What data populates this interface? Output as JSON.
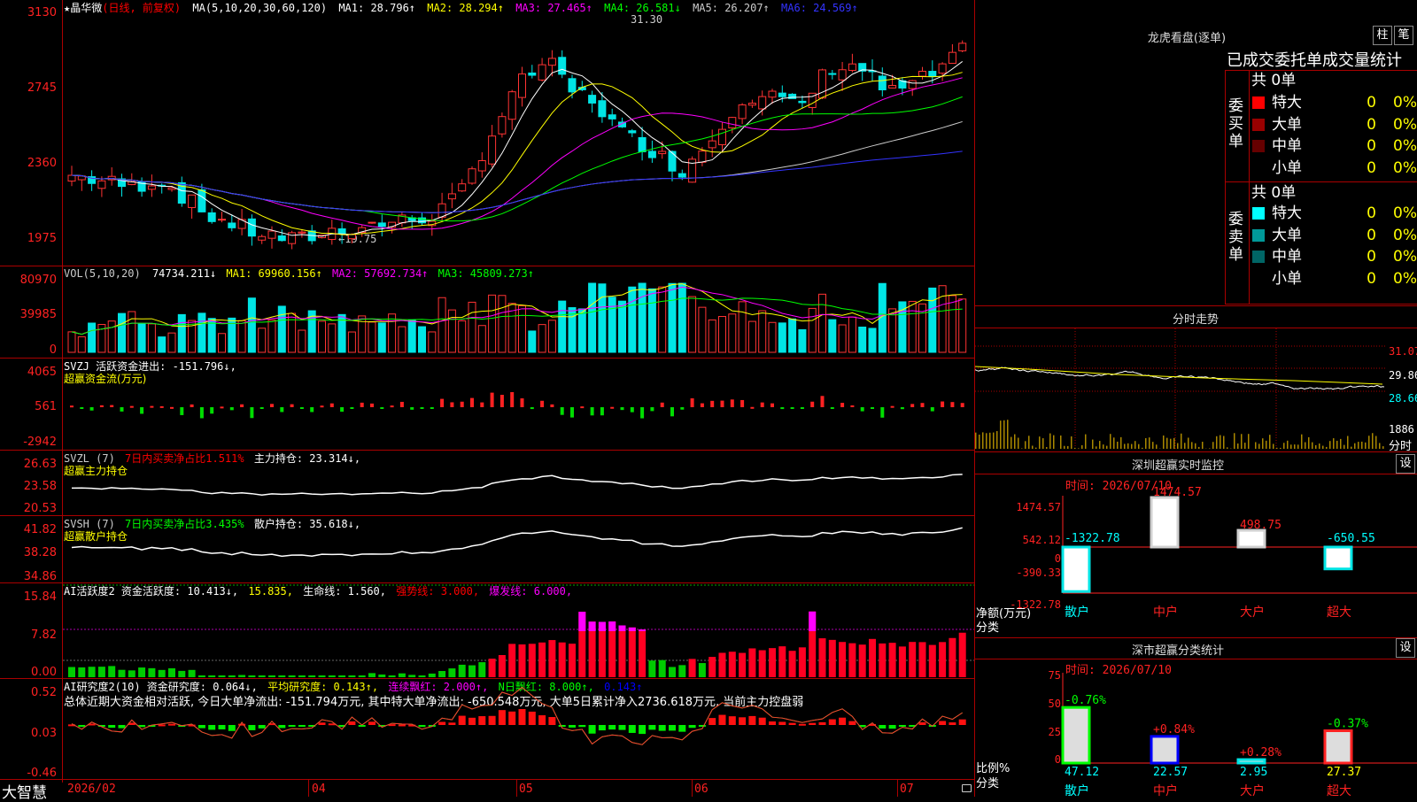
{
  "stock": {
    "name_line": "★晶华微(日线, 前复权)",
    "name": "★晶华微",
    "mode": "(日线, 前复权)",
    "ma_label": "MA(5,10,20,30,60,120)",
    "ma": [
      {
        "label": "MA1: 28.796↑",
        "color": "#ffffff"
      },
      {
        "label": "MA2: 28.294↑",
        "color": "#ffff00"
      },
      {
        "label": "MA3: 27.465↑",
        "color": "#ff00ff"
      },
      {
        "label": "MA4: 26.581↓",
        "color": "#00ff00"
      },
      {
        "label": "MA5: 26.207↑",
        "color": "#cccccc"
      },
      {
        "label": "MA6: 24.569↑",
        "color": "#3333ff"
      }
    ],
    "price_axis": [
      "3130",
      "2745",
      "2360",
      "1975"
    ],
    "high_label": "31.30",
    "low_label": "←19.75"
  },
  "vol": {
    "title": "VOL(5,10,20)",
    "value": "74734.211↓",
    "ma1": "MA1: 69960.156↑",
    "ma2": "MA2: 57692.734↑",
    "ma3": "MA3: 45809.273↑",
    "axis": [
      "80970",
      "39985",
      "0"
    ]
  },
  "svzj": {
    "title": "SVZJ  活跃资金进出: -151.796↓,",
    "sub": "超赢资金流(万元)",
    "axis": [
      "4065",
      "561",
      "-2942"
    ]
  },
  "svzl": {
    "title_a": "SVZL (7)",
    "title_b": "7日内买卖净占比1.511%",
    "title_c": "主力持仓: 23.314↓,",
    "sub": "超赢主力持仓",
    "axis": [
      "26.63",
      "23.58",
      "20.53"
    ]
  },
  "svsh": {
    "title_a": "SVSH (7)",
    "title_b": "7日内买卖净占比3.435%",
    "title_c": "散户持仓: 35.618↓,",
    "sub": "超赢散户持仓",
    "axis": [
      "41.82",
      "38.28",
      "34.86"
    ]
  },
  "ai_active": {
    "title_a": "AI活跃度2  资金活跃度: 10.413↓,",
    "title_b": "15.835,",
    "title_c": "生命线: 1.560,",
    "title_d": "强势线: 3.000,",
    "title_e": "爆发线: 6.000,",
    "axis": [
      "15.84",
      "7.82",
      "0.00"
    ]
  },
  "ai_research": {
    "title_a": "AI研究度2(10)  资金研究度: 0.064↓,",
    "title_b": "平均研究度: 0.143↑,",
    "title_c": "连续飘红: 2.000↑,",
    "title_d": "N日飘红: 8.000↑,",
    "title_e": "0.143↑",
    "summary": "总体近期大资金相对活跃, 今日大单净流出: -151.794万元, 其中特大单净流出: -650.548万元, 大单5日累计净入2736.618万元, 当前主力控盘弱",
    "axis": [
      "0.52",
      "0.03",
      "-0.46"
    ]
  },
  "bottom_bar": {
    "brand": "大智慧",
    "dates": [
      "2026/02",
      "04",
      "05",
      "06",
      "07"
    ]
  },
  "dragon": {
    "title": "龙虎看盘(逐单)",
    "btn1": "柱",
    "btn2": "笔",
    "header": "已成交委托单成交量统计",
    "buy_side": "委买单",
    "sell_side": "委卖单",
    "buy_total": "共 0单",
    "sell_total": "共 0单",
    "buy_rows": [
      {
        "label": "特大",
        "v": "0",
        "p": "0%",
        "color": "#ff0000"
      },
      {
        "label": "大单",
        "v": "0",
        "p": "0%",
        "color": "#990000"
      },
      {
        "label": "中单",
        "v": "0",
        "p": "0%",
        "color": "#660000"
      },
      {
        "label": "小单",
        "v": "0",
        "p": "0%",
        "color": "#000000"
      }
    ],
    "sell_rows": [
      {
        "label": "特大",
        "v": "0",
        "p": "0%",
        "color": "#00ffff"
      },
      {
        "label": "大单",
        "v": "0",
        "p": "0%",
        "color": "#009999"
      },
      {
        "label": "中单",
        "v": "0",
        "p": "0%",
        "color": "#006666"
      },
      {
        "label": "小单",
        "v": "0",
        "p": "0%",
        "color": "#000000"
      }
    ]
  },
  "intraday": {
    "title": "分时走势",
    "axis": [
      "31.07",
      "29.86",
      "28.66",
      "1886"
    ],
    "unit": "分时"
  },
  "sz_monitor": {
    "title": "深圳超赢实时监控",
    "btn": "设",
    "time": "时间: 2026/07/10",
    "axis": [
      "1474.57",
      "542.12",
      "0",
      "-390.33",
      "-1322.78"
    ],
    "unit1": "净额(万元)",
    "unit2": "分类",
    "categories": [
      "散户",
      "中户",
      "大户",
      "超大"
    ],
    "values": [
      "-1322.78",
      "1474.57",
      "498.75",
      "-650.55"
    ]
  },
  "sz_class": {
    "title": "深市超赢分类统计",
    "btn": "设",
    "time": "时间: 2026/07/10",
    "axis": [
      "75",
      "50",
      "25",
      "0"
    ],
    "unit1": "比例%",
    "unit2": "分类",
    "categories": [
      "散户",
      "中户",
      "大户",
      "超大"
    ],
    "changes": [
      "-0.76%",
      "+0.84%",
      "+0.28%",
      "-0.37%"
    ],
    "values": [
      "47.12",
      "22.57",
      "2.95",
      "27.37"
    ]
  }
}
